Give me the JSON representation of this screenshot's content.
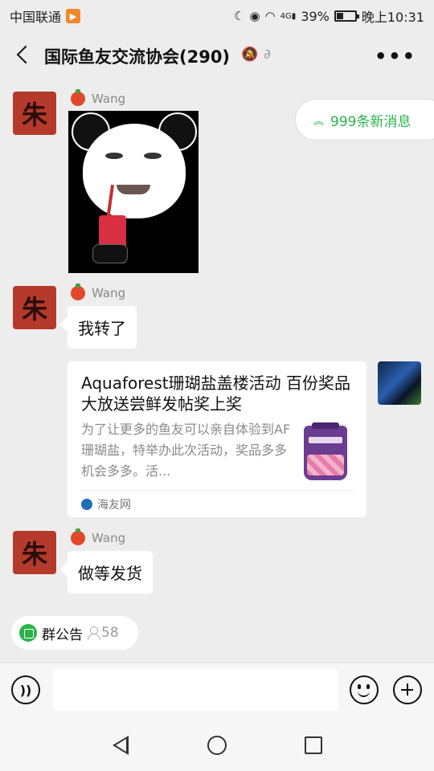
{
  "status_bar": {
    "carrier": "中国联通",
    "battery": "39%",
    "time": "晚上10:31",
    "network": "4G"
  },
  "header": {
    "title": "国际鱼友交流协会(290)",
    "more_label": "•••"
  },
  "new_messages": {
    "label": "999条新消息"
  },
  "messages": [
    {
      "sender": "Wang",
      "type": "sticker"
    },
    {
      "sender": "Wang",
      "type": "text",
      "text": "我转了"
    },
    {
      "sender": "self",
      "type": "link_card",
      "card": {
        "title": "Aquaforest珊瑚盐盖楼活动 百份奖品大放送尝鲜发帖奖上奖",
        "description": "为了让更多的鱼友可以亲自体验到AF珊瑚盐，特举办此次活动，奖品多多机会多多。活...",
        "source": "海友网"
      }
    },
    {
      "sender": "Wang",
      "type": "text",
      "text": "做等发货"
    }
  ],
  "announcement": {
    "label": "群公告",
    "member_count": "58"
  },
  "input": {
    "placeholder": ""
  },
  "icons": [
    "back-icon",
    "mute-icon",
    "ear-icon",
    "more-icon",
    "voice-icon",
    "emoji-icon",
    "plus-icon",
    "nav-back-icon",
    "nav-home-icon",
    "nav-recent-icon"
  ],
  "colors": {
    "accent_green": "#2ab34a",
    "background": "#ededed",
    "bubble": "#ffffff"
  }
}
